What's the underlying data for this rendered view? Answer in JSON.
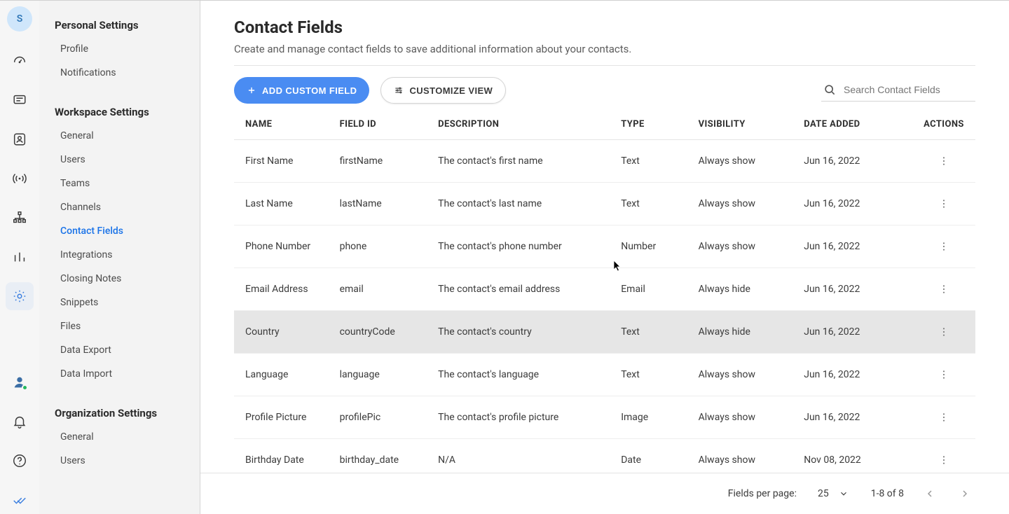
{
  "avatar_initial": "S",
  "nav": {
    "personal_heading": "Personal Settings",
    "personal_items": [
      "Profile",
      "Notifications"
    ],
    "workspace_heading": "Workspace Settings",
    "workspace_items": [
      "General",
      "Users",
      "Teams",
      "Channels",
      "Contact Fields",
      "Integrations",
      "Closing Notes",
      "Snippets",
      "Files",
      "Data Export",
      "Data Import"
    ],
    "workspace_selected_index": 4,
    "org_heading": "Organization Settings",
    "org_items": [
      "General",
      "Users"
    ]
  },
  "header": {
    "title": "Contact Fields",
    "subtitle": "Create and manage contact fields to save additional information about your contacts."
  },
  "toolbar": {
    "add_label": "ADD CUSTOM FIELD",
    "customize_label": "CUSTOMIZE VIEW",
    "search_placeholder": "Search Contact Fields"
  },
  "table": {
    "columns": [
      "NAME",
      "FIELD ID",
      "DESCRIPTION",
      "TYPE",
      "VISIBILITY",
      "DATE ADDED",
      "ACTIONS"
    ],
    "rows": [
      {
        "name": "First Name",
        "field_id": "firstName",
        "description": "The contact's first name",
        "type": "Text",
        "visibility": "Always show",
        "date": "Jun 16, 2022",
        "highlight": false
      },
      {
        "name": "Last Name",
        "field_id": "lastName",
        "description": "The contact's last name",
        "type": "Text",
        "visibility": "Always show",
        "date": "Jun 16, 2022",
        "highlight": false
      },
      {
        "name": "Phone Number",
        "field_id": "phone",
        "description": "The contact's phone number",
        "type": "Number",
        "visibility": "Always show",
        "date": "Jun 16, 2022",
        "highlight": false
      },
      {
        "name": "Email Address",
        "field_id": "email",
        "description": "The contact's email address",
        "type": "Email",
        "visibility": "Always hide",
        "date": "Jun 16, 2022",
        "highlight": false
      },
      {
        "name": "Country",
        "field_id": "countryCode",
        "description": "The contact's country",
        "type": "Text",
        "visibility": "Always hide",
        "date": "Jun 16, 2022",
        "highlight": true
      },
      {
        "name": "Language",
        "field_id": "language",
        "description": "The contact's language",
        "type": "Text",
        "visibility": "Always show",
        "date": "Jun 16, 2022",
        "highlight": false
      },
      {
        "name": "Profile Picture",
        "field_id": "profilePic",
        "description": "The contact's profile picture",
        "type": "Image",
        "visibility": "Always show",
        "date": "Jun 16, 2022",
        "highlight": false
      },
      {
        "name": "Birthday Date",
        "field_id": "birthday_date",
        "description": "N/A",
        "type": "Date",
        "visibility": "Always show",
        "date": "Nov 08, 2022",
        "highlight": false
      }
    ]
  },
  "footer": {
    "per_page_label": "Fields per page:",
    "per_page_value": "25",
    "range_text": "1-8 of 8"
  }
}
